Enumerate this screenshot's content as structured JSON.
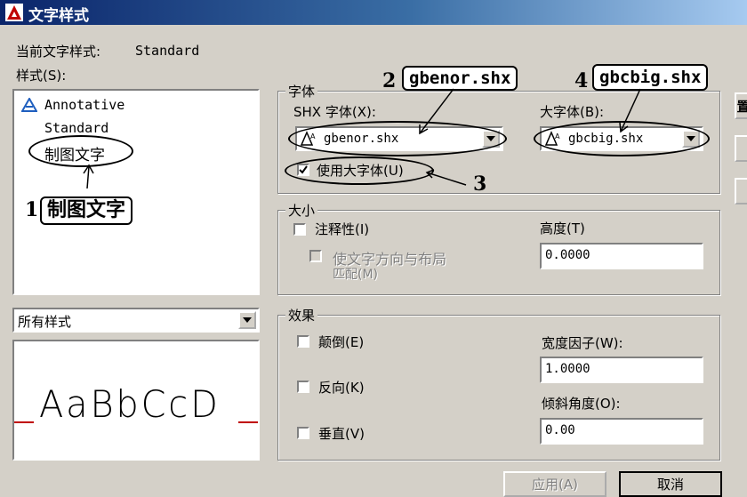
{
  "window": {
    "title": "文字样式"
  },
  "current_style": {
    "label": "当前文字样式:",
    "value": "Standard"
  },
  "styles": {
    "label": "样式(S):",
    "items": [
      "Annotative",
      "Standard",
      "制图文字"
    ],
    "filter_value": "所有样式"
  },
  "preview": {
    "text": "AaBbCcD"
  },
  "font": {
    "legend": "字体",
    "shx_label": "SHX 字体(X):",
    "shx_value": "gbenor.shx",
    "big_label": "大字体(B):",
    "big_value": "gbcbig.shx",
    "use_big_label": "使用大字体(U)",
    "use_big_checked": true
  },
  "size": {
    "legend": "大小",
    "annotative_label": "注释性(I)",
    "match_label_1": "使文字方向与布局",
    "match_label_2": "匹配(M)",
    "height_label": "高度(T)",
    "height_value": "0.0000"
  },
  "effects": {
    "legend": "效果",
    "upside_down": "颠倒(E)",
    "backwards": "反向(K)",
    "vertical": "垂直(V)",
    "width_label": "宽度因子(W):",
    "width_value": "1.0000",
    "oblique_label": "倾斜角度(O):",
    "oblique_value": "0.00"
  },
  "buttons": {
    "apply": "应用(A)",
    "cancel": "取消",
    "side_partial": "置"
  },
  "annotations": {
    "n1": "1",
    "c1": "制图文字",
    "n2": "2",
    "c2": "gbenor.shx",
    "n3": "3",
    "n4": "4",
    "c4": "gbcbig.shx"
  },
  "colors": {
    "title_start": "#0a246a",
    "title_end": "#a6caf0",
    "dialog_bg": "#d4d0c8",
    "preview_baseline": "#c00000"
  }
}
